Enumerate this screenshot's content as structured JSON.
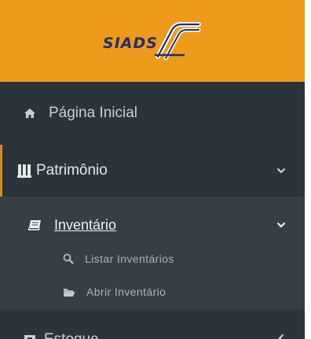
{
  "header": {
    "logo_text": "SIADS",
    "brand_color": "#ef9a1b"
  },
  "menu": {
    "home": {
      "label": "Página Inicial",
      "icon": "home-icon"
    },
    "patrimonio": {
      "label": "Patrimônio",
      "icon": "columns-icon"
    },
    "inventario": {
      "label": "Inventário",
      "icon": "book-icon"
    },
    "listar": {
      "label": "Listar Inventários",
      "icon": "search-icon"
    },
    "abrir": {
      "label": "Abrir Inventário",
      "icon": "folder-open-icon"
    },
    "estoque": {
      "label": "Estoque",
      "icon": "box-icon"
    }
  },
  "colors": {
    "sidebar_bg": "#2b3438",
    "submenu_bg": "#353f45",
    "active_accent": "#d48a23"
  }
}
